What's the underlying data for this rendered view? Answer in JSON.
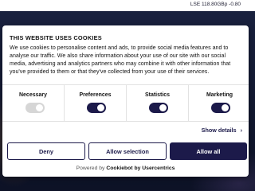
{
  "header": {
    "ticker": "LSE 118.80GBp -0.80"
  },
  "consent": {
    "title": "THIS WEBSITE USES COOKIES",
    "body": "We use cookies to personalise content and ads, to provide social media features and to analyse our traffic. We also share information about your use of our site with our social media, advertising and analytics partners who may combine it with other information that you've provided to them or that they've collected from your use of their services.",
    "categories": [
      {
        "label": "Necessary",
        "enabled": true,
        "locked": true
      },
      {
        "label": "Preferences",
        "enabled": true,
        "locked": false
      },
      {
        "label": "Statistics",
        "enabled": true,
        "locked": false
      },
      {
        "label": "Marketing",
        "enabled": true,
        "locked": false
      }
    ],
    "show_details": "Show details",
    "buttons": {
      "deny": "Deny",
      "allow_selection": "Allow selection",
      "allow_all": "Allow all"
    },
    "powered_prefix": "Powered by",
    "powered_brand": "Cookiebot by Usercentrics"
  },
  "colors": {
    "accent": "#1c1a4a",
    "backdrop": "#10172e"
  }
}
